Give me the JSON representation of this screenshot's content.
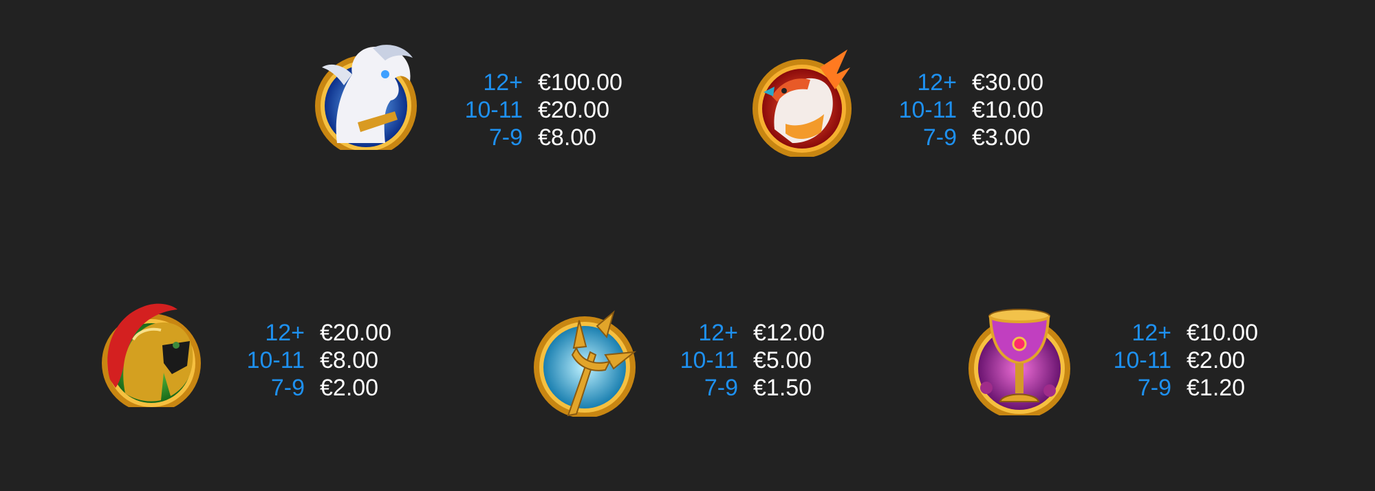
{
  "paytable": [
    {
      "id": "pegasus",
      "icon": "pegasus-icon",
      "rows": [
        {
          "count": "12+",
          "value": "€100.00"
        },
        {
          "count": "10-11",
          "value": "€20.00"
        },
        {
          "count": "7-9",
          "value": "€8.00"
        }
      ]
    },
    {
      "id": "phoenix",
      "icon": "phoenix-icon",
      "rows": [
        {
          "count": "12+",
          "value": "€30.00"
        },
        {
          "count": "10-11",
          "value": "€10.00"
        },
        {
          "count": "7-9",
          "value": "€3.00"
        }
      ]
    },
    {
      "id": "helmet",
      "icon": "spartan-helmet-icon",
      "rows": [
        {
          "count": "12+",
          "value": "€20.00"
        },
        {
          "count": "10-11",
          "value": "€8.00"
        },
        {
          "count": "7-9",
          "value": "€2.00"
        }
      ]
    },
    {
      "id": "trident",
      "icon": "trident-icon",
      "rows": [
        {
          "count": "12+",
          "value": "€12.00"
        },
        {
          "count": "10-11",
          "value": "€5.00"
        },
        {
          "count": "7-9",
          "value": "€1.50"
        }
      ]
    },
    {
      "id": "chalice",
      "icon": "chalice-icon",
      "rows": [
        {
          "count": "12+",
          "value": "€10.00"
        },
        {
          "count": "10-11",
          "value": "€2.00"
        },
        {
          "count": "7-9",
          "value": "€1.20"
        }
      ]
    }
  ],
  "colors": {
    "background": "#222222",
    "count_text": "#1e90ef",
    "value_text": "#ffffff",
    "frame_gold": "#e0a020"
  }
}
